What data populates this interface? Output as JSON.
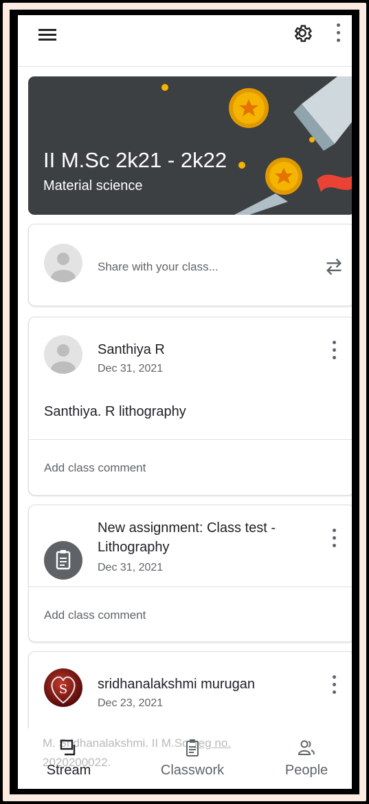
{
  "banner": {
    "title": "II M.Sc 2k21 - 2k22",
    "subtitle": "Material science"
  },
  "share": {
    "placeholder": "Share with your class..."
  },
  "posts": [
    {
      "author": "Santhiya R",
      "date": "Dec 31, 2021",
      "body": "Santhiya. R lithography",
      "comment_label": "Add class comment"
    },
    {
      "title_line1": "New assignment: Class test -",
      "title_line2": "Lithography",
      "date": "Dec 31, 2021",
      "comment_label": "Add class comment"
    },
    {
      "author": "sridhanalakshmi murugan",
      "date": "Dec 23, 2021",
      "avatar_letter": "S",
      "body_peek_line1": "M. Sridhanalakshmi. II M.Sc: ",
      "body_peek_link": "reg no.",
      "body_peek_line2": "2020200022."
    }
  ],
  "nav": {
    "items": [
      {
        "label": "Stream",
        "icon": "stream-icon",
        "active": true
      },
      {
        "label": "Classwork",
        "icon": "classwork-icon",
        "active": false
      },
      {
        "label": "People",
        "icon": "people-icon",
        "active": false
      }
    ]
  },
  "colors": {
    "banner_bg": "#3c4043",
    "accent_gold": "#f4b400",
    "text_primary": "#202124",
    "text_secondary": "#5f6368"
  }
}
